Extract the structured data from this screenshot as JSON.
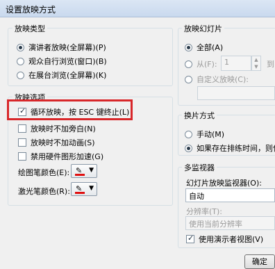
{
  "window": {
    "title": "设置放映方式"
  },
  "show_type": {
    "title": "放映类型",
    "options": [
      {
        "label": "演讲者放映(全屏幕)(P)",
        "checked": true
      },
      {
        "label": "观众自行浏览(窗口)(B)",
        "checked": false
      },
      {
        "label": "在展台浏览(全屏幕)(K)",
        "checked": false
      }
    ]
  },
  "show_slides": {
    "title": "放映幻灯片",
    "all_label": "全部(A)",
    "from_label": "从(F):",
    "from_value": "1",
    "to_label": "到(T):",
    "custom_label": "自定义放映(C):"
  },
  "show_options": {
    "title": "放映选项",
    "items": [
      {
        "label": "循环放映，按 ESC 键终止(L)",
        "checked": true
      },
      {
        "label": "放映时不加旁白(N)",
        "checked": false
      },
      {
        "label": "放映时不加动画(S)",
        "checked": false
      },
      {
        "label": "禁用硬件图形加速(G)",
        "checked": false
      }
    ],
    "pen_color_label": "绘图笔颜色(E):",
    "laser_color_label": "激光笔颜色(R):",
    "pen_color": "#e01010",
    "laser_color": "#e01010"
  },
  "advance": {
    "title": "换片方式",
    "manual_label": "手动(M)",
    "timing_label": "如果存在排练时间，则使"
  },
  "monitors": {
    "title": "多监视器",
    "monitor_label": "幻灯片放映监视器(O):",
    "monitor_value": "自动",
    "resolution_label": "分辨率(T):",
    "resolution_value": "使用当前分辨率",
    "presenter_view_label": "使用演示者视图(V)"
  },
  "buttons": {
    "ok": "确定"
  }
}
